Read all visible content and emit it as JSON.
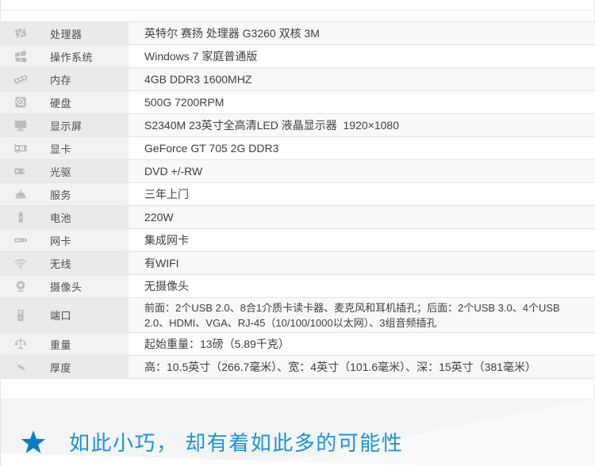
{
  "table": {
    "rows": [
      {
        "icon": "cpu",
        "label": "处理器",
        "value": "英特尔 赛扬 处理器 G3260 双核 3M"
      },
      {
        "icon": "windows",
        "label": "操作系统",
        "value": "Windows 7 家庭普通版"
      },
      {
        "icon": "ram",
        "label": "内存",
        "value": "4GB DDR3 1600MHZ"
      },
      {
        "icon": "hdd",
        "label": "硬盘",
        "value": "500G 7200RPM"
      },
      {
        "icon": "monitor",
        "label": "显示屏",
        "value": "S2340M 23英寸全高清LED 液晶显示器  1920×1080"
      },
      {
        "icon": "gpu",
        "label": "显卡",
        "value": "GeForce GT 705 2G DDR3"
      },
      {
        "icon": "optical-drive",
        "label": "光驱",
        "value": "DVD +/-RW"
      },
      {
        "icon": "service-bell",
        "label": "服务",
        "value": "三年上门"
      },
      {
        "icon": "battery",
        "label": "电池",
        "value": "220W"
      },
      {
        "icon": "network-card",
        "label": "网卡",
        "value": "集成网卡"
      },
      {
        "icon": "wifi",
        "label": "无线",
        "value": "有WIFI"
      },
      {
        "icon": "webcam",
        "label": "摄像头",
        "value": "无摄像头"
      },
      {
        "icon": "tower",
        "label": "端口",
        "value": "前面：2个USB 2.0、8合1介质卡读卡器、麦克风和耳机插孔；后面：2个USB 3.0、4个USB 2.0、HDMI、VGA、RJ-45（10/100/1000以太网）、3组音频插孔",
        "tall": true
      },
      {
        "icon": "scale",
        "label": "重量",
        "value": "起始重量：13磅（5.89千克）"
      },
      {
        "icon": "caliper",
        "label": "厚度",
        "value": "高：10.5英寸（266.7毫米）、宽：4英寸（101.6毫米）、深：15英寸（381毫米）"
      }
    ]
  },
  "banner": {
    "star_icon": "star-icon",
    "slogan": "如此小巧， 却有着如此多的可能性"
  },
  "colors": {
    "star_blue": "#0d7cc4",
    "slogan_blue": "#2193d2",
    "icon_gray": "#bcbcbc"
  }
}
